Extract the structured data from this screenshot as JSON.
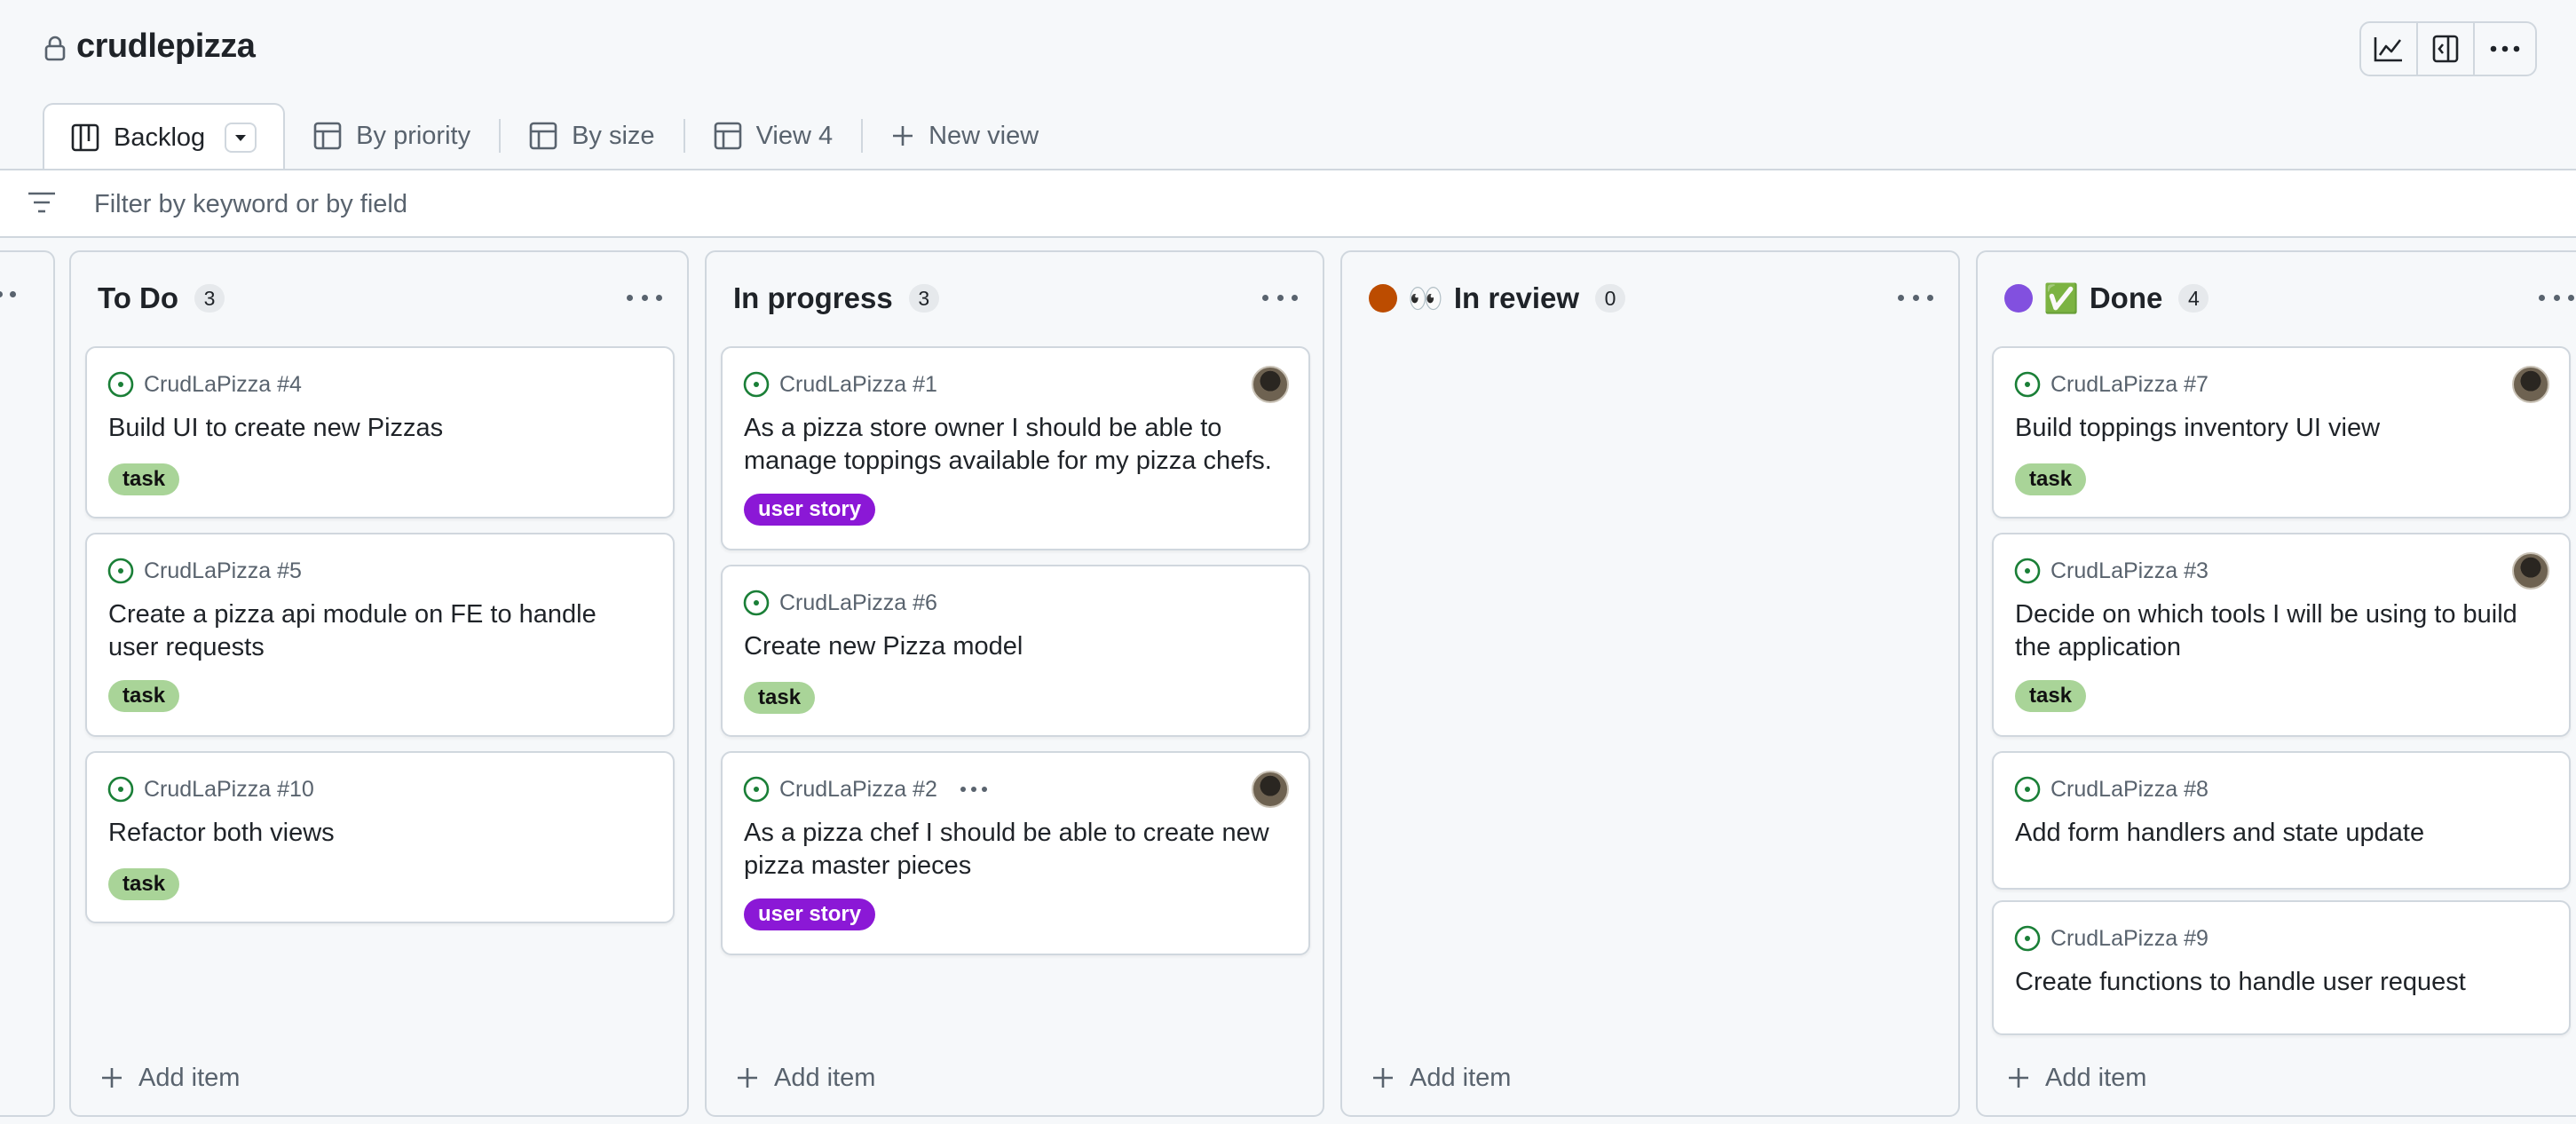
{
  "project": {
    "title": "crudlepizza"
  },
  "toolbar": {
    "insights_icon": "graph-icon",
    "panel_icon": "sidebar-expand-icon",
    "more_icon": "kebab-horizontal-icon"
  },
  "views": [
    {
      "label": "Backlog",
      "icon": "board-icon",
      "active": true
    },
    {
      "label": "By priority",
      "icon": "table-icon"
    },
    {
      "label": "By size",
      "icon": "table-icon"
    },
    {
      "label": "View 4",
      "icon": "table-icon"
    },
    {
      "label": "New view",
      "icon": "plus-icon"
    }
  ],
  "filter": {
    "placeholder": "Filter by keyword or by field"
  },
  "colors": {
    "in_review_dot": "#bc4c00",
    "done_dot": "#8250df",
    "task_label": "#a9d498",
    "story_label": "#8b18d6",
    "open_issue": "#1a7f37"
  },
  "columns": [
    {
      "title": "To Do",
      "count": "3",
      "add_label": "Add item",
      "cards": [
        {
          "ref": "CrudLaPizza #4",
          "title": "Build UI to create new Pizzas",
          "label": "task"
        },
        {
          "ref": "CrudLaPizza #5",
          "title": "Create a pizza api module on FE to handle user requests",
          "label": "task"
        },
        {
          "ref": "CrudLaPizza #10",
          "title": "Refactor both views",
          "label": "task"
        }
      ]
    },
    {
      "title": "In progress",
      "count": "3",
      "add_label": "Add item",
      "cards": [
        {
          "ref": "CrudLaPizza #1",
          "title": "As a pizza store owner I should be able to manage toppings available for my pizza chefs.",
          "label": "user story"
        },
        {
          "ref": "CrudLaPizza #6",
          "title": "Create new Pizza model",
          "label": "task"
        },
        {
          "ref": "CrudLaPizza #2",
          "title": "As a pizza chef I should be able to create new pizza master pieces",
          "label": "user story"
        }
      ]
    },
    {
      "title": "In review",
      "emoji": "👀",
      "count": "0",
      "add_label": "Add item",
      "cards": []
    },
    {
      "title": "Done",
      "emoji": "✅",
      "count": "4",
      "add_label": "Add item",
      "cards": [
        {
          "ref": "CrudLaPizza #7",
          "title": "Build toppings inventory UI view",
          "label": "task"
        },
        {
          "ref": "CrudLaPizza #3",
          "title": "Decide on which tools I will be using to build the application",
          "label": "task"
        },
        {
          "ref": "CrudLaPizza #8",
          "title": "Add form handlers and state update"
        },
        {
          "ref": "CrudLaPizza #9",
          "title": "Create functions to handle user request"
        }
      ]
    }
  ]
}
